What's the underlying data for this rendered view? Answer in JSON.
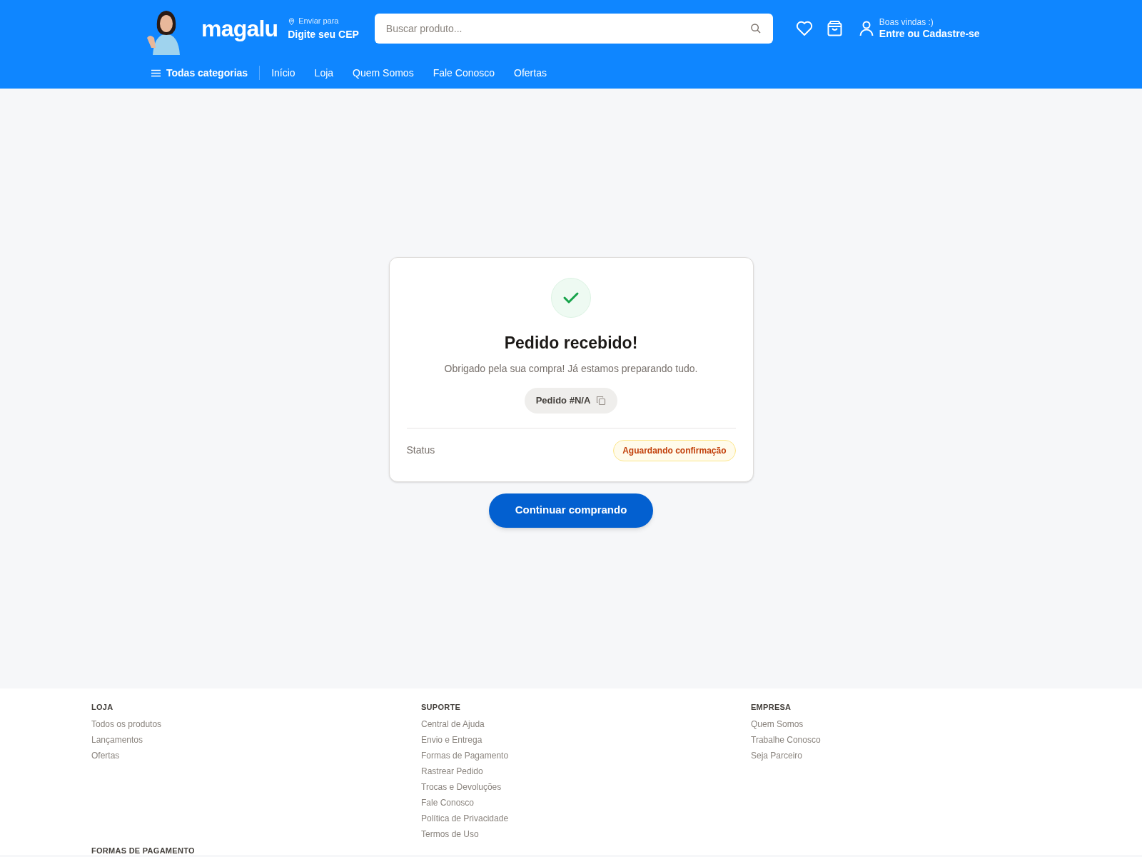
{
  "header": {
    "logo": "magalu",
    "delivery": {
      "label": "Enviar para",
      "value": "Digite seu CEP"
    },
    "search": {
      "placeholder": "Buscar produto..."
    },
    "account": {
      "greeting": "Boas vindas :)",
      "action": "Entre ou Cadastre-se"
    }
  },
  "nav": {
    "categories": "Todas categorias",
    "links": [
      "Início",
      "Loja",
      "Quem Somos",
      "Fale Conosco",
      "Ofertas"
    ]
  },
  "confirmation": {
    "title": "Pedido recebido!",
    "message": "Obrigado pela sua compra! Já estamos preparando tudo.",
    "order": "Pedido #N/A",
    "status_label": "Status",
    "status": "Aguardando confirmação",
    "button": "Continuar comprando"
  },
  "footer": {
    "columns": [
      {
        "title": "LOJA",
        "links": [
          "Todos os produtos",
          "Lançamentos",
          "Ofertas"
        ]
      },
      {
        "title": "SUPORTE",
        "links": [
          "Central de Ajuda",
          "Envio e Entrega",
          "Formas de Pagamento",
          "Rastrear Pedido",
          "Trocas e Devoluções",
          "Fale Conosco",
          "Política de Privacidade",
          "Termos de Uso"
        ]
      },
      {
        "title": "EMPRESA",
        "links": [
          "Quem Somos",
          "Trabalhe Conosco",
          "Seja Parceiro"
        ]
      }
    ],
    "payments_title": "FORMAS DE PAGAMENTO"
  }
}
